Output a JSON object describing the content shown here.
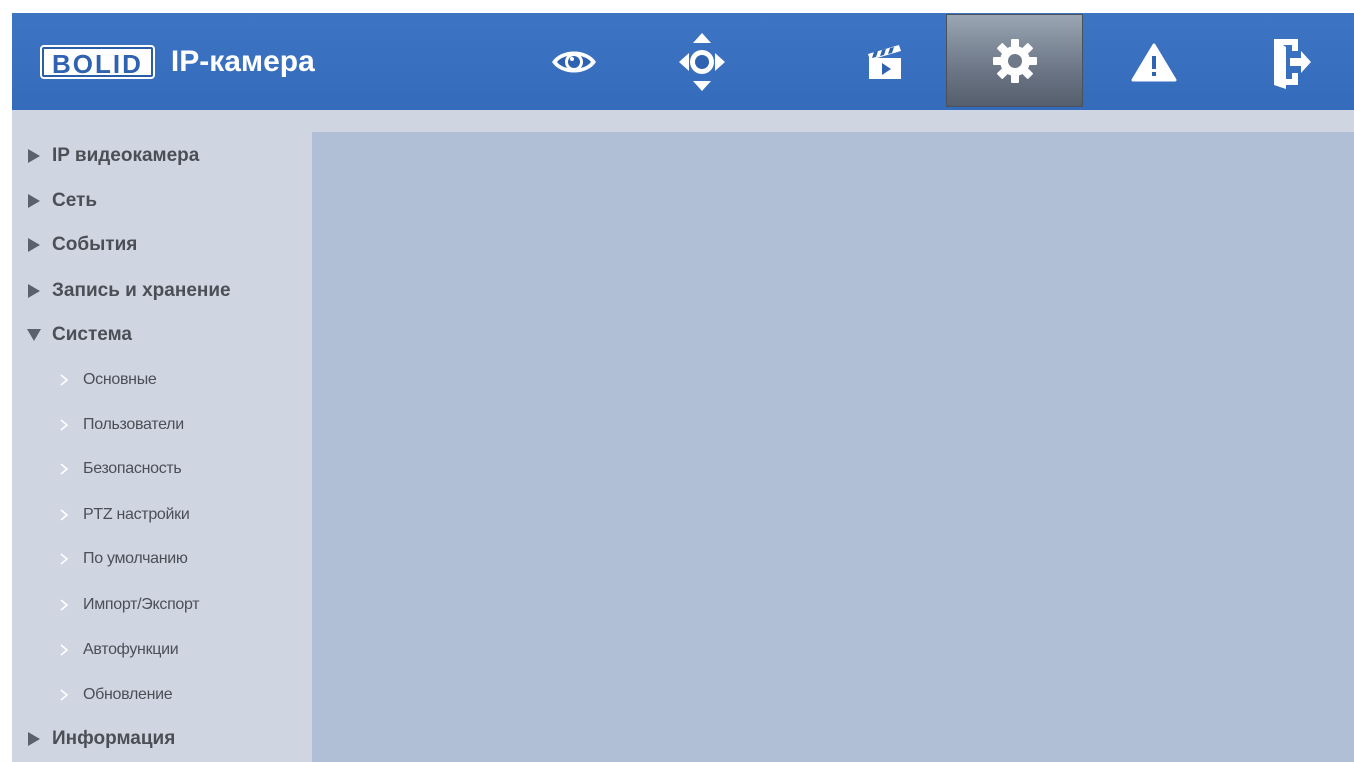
{
  "header": {
    "logo_text": "BOLID",
    "app_title": "IP-камера",
    "nav": [
      {
        "icon": "eye-icon",
        "name": "live-view"
      },
      {
        "icon": "ptz-icon",
        "name": "ptz"
      },
      {
        "icon": "clapperboard-icon",
        "name": "playback"
      },
      {
        "icon": "gear-icon",
        "name": "settings",
        "active": true
      },
      {
        "icon": "warning-icon",
        "name": "alarm"
      },
      {
        "icon": "logout-icon",
        "name": "logout"
      }
    ]
  },
  "sidebar": {
    "sections": [
      {
        "label": "IP видеокамера",
        "expanded": false
      },
      {
        "label": "Сеть",
        "expanded": false
      },
      {
        "label": "События",
        "expanded": false
      },
      {
        "label": "Запись и хранение",
        "expanded": false
      },
      {
        "label": "Система",
        "expanded": true
      },
      {
        "label": "Информация",
        "expanded": false
      }
    ],
    "system_items": [
      {
        "label": "Основные"
      },
      {
        "label": "Пользователи"
      },
      {
        "label": "Безопасность"
      },
      {
        "label": "PTZ настройки"
      },
      {
        "label": "По умолчанию"
      },
      {
        "label": "Импорт/Экспорт"
      },
      {
        "label": "Автофункции"
      },
      {
        "label": "Обновление"
      }
    ]
  },
  "colors": {
    "header_blue": "#3a70c0",
    "sidebar_bg": "#cfd6e2",
    "content_bg": "#b0bfd6",
    "menu_text": "#4b4f56"
  }
}
